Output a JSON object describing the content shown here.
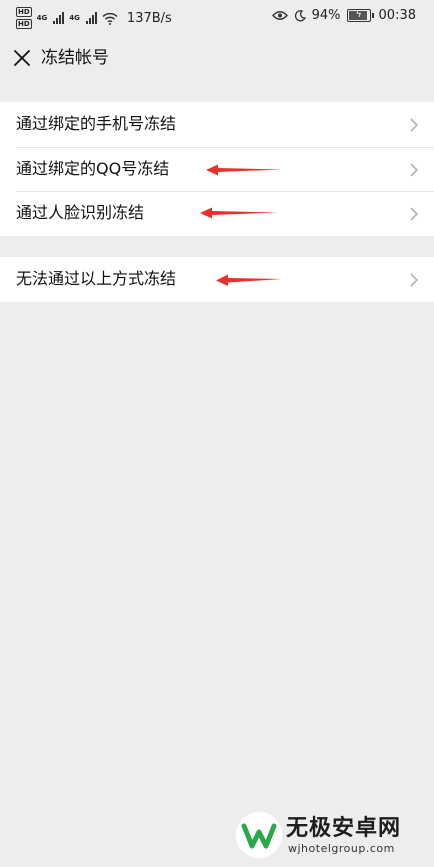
{
  "status_bar": {
    "network_speed": "137B/s",
    "battery_percent": "94%",
    "time": "00:38",
    "hd_label": "HD",
    "network_type": "4G",
    "battery_level": 0.94
  },
  "nav": {
    "title": "冻结帐号"
  },
  "options_group_1": {
    "items": [
      {
        "label": "通过绑定的手机号冻结"
      },
      {
        "label": "通过绑定的QQ号冻结"
      },
      {
        "label": "通过人脸识别冻结"
      }
    ]
  },
  "options_group_2": {
    "items": [
      {
        "label": "无法通过以上方式冻结"
      }
    ]
  },
  "annotation_color": "#e8312c",
  "watermark": {
    "title": "无极安卓网",
    "url": "wjhotelgroup.com"
  }
}
